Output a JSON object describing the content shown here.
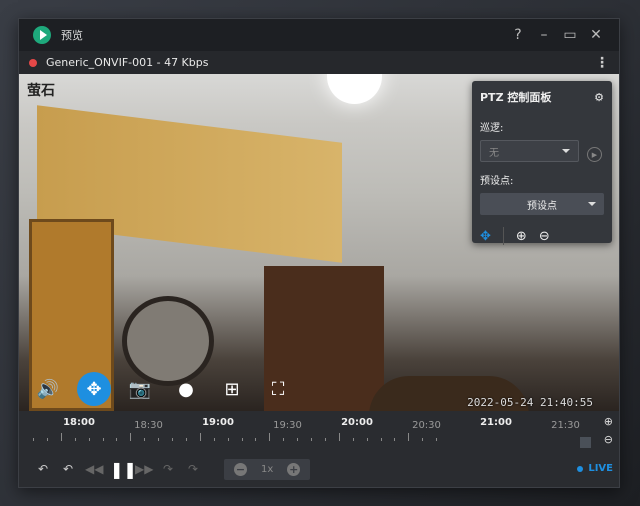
{
  "window": {
    "title": "预览",
    "help": "?",
    "minimize": "–",
    "maximize": "▭",
    "close": "✕"
  },
  "device": {
    "name": "Generic_ONVIF-001 - 47 Kbps",
    "menu": "⋮"
  },
  "video": {
    "watermark": "萤石",
    "timestamp": "2022-05-24 21:40:55"
  },
  "video_controls": [
    {
      "name": "volume-icon",
      "glyph": "🔊"
    },
    {
      "name": "ptz-icon",
      "glyph": "✥"
    },
    {
      "name": "camera-icon",
      "glyph": "📷"
    },
    {
      "name": "record-icon",
      "glyph": "●"
    },
    {
      "name": "zoom-region-icon",
      "glyph": "⊞"
    },
    {
      "name": "fullscreen-icon",
      "glyph": "⛶"
    }
  ],
  "ptz": {
    "title": "PTZ 控制面板",
    "cruise_label": "巡逻:",
    "cruise_value": "无",
    "preset_label": "预设点:",
    "preset_value": "预设点",
    "zoom_in": "⊕",
    "zoom_out": "⊖",
    "move": "✥"
  },
  "timeline": {
    "labels": [
      "18:00",
      "18:30",
      "19:00",
      "19:30",
      "20:00",
      "20:30",
      "21:00",
      "21:30"
    ],
    "zoom_in": "⊕",
    "zoom_out": "⊖"
  },
  "playback": {
    "speed": "1x",
    "minus": "−",
    "plus": "+",
    "live": "LIVE"
  },
  "accent": "#1e8fe0"
}
